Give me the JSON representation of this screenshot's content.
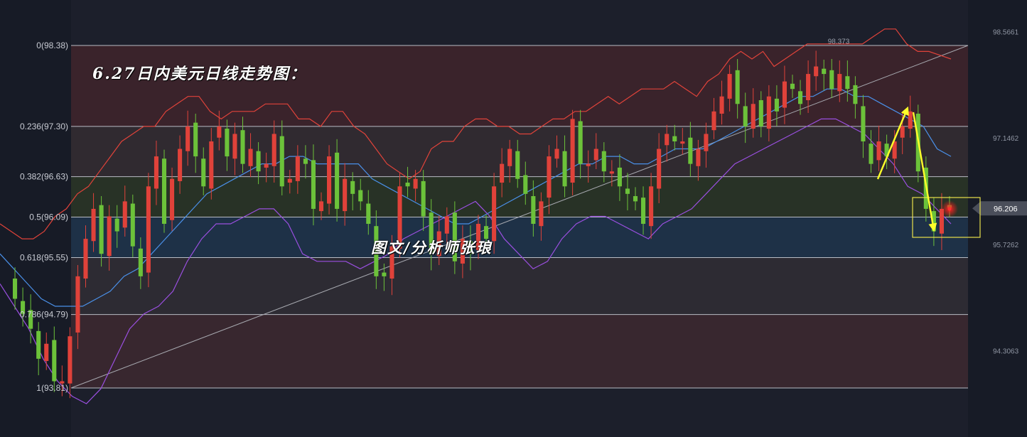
{
  "chart_data": {
    "type": "candlestick",
    "title": "6.27日内美元日线走势图：",
    "watermark": "图文/分析师张琅",
    "y_range": [
      92.9,
      99.0
    ],
    "fib_levels": [
      {
        "ratio": "0",
        "price": 98.38,
        "label": "0(98.38)"
      },
      {
        "ratio": "0.236",
        "price": 97.3,
        "label": "0.236(97.30)"
      },
      {
        "ratio": "0.382",
        "price": 96.63,
        "label": "0.382(96.63)"
      },
      {
        "ratio": "0.5",
        "price": 96.09,
        "label": "0.5(96.09)"
      },
      {
        "ratio": "0.618",
        "price": 95.55,
        "label": "0.618(95.55)"
      },
      {
        "ratio": "0.786",
        "price": 94.79,
        "label": "0.786(94.79)"
      },
      {
        "ratio": "1",
        "price": 93.81,
        "label": "1(93.81)"
      }
    ],
    "right_axis_ticks": [
      "98.5661",
      "97.1462",
      "95.7262",
      "94.3063"
    ],
    "right_axis_values": [
      98.5661,
      97.1462,
      95.7262,
      94.3063
    ],
    "current_price": "96.206",
    "current_price_value": 96.206,
    "high_marker": "98.373",
    "high_marker_value": 98.373,
    "trendline": {
      "from": 93.81,
      "to": 98.38
    },
    "closes": [
      95.3,
      95.0,
      94.8,
      94.6,
      94.2,
      94.4,
      93.9,
      93.9,
      94.5,
      95.3,
      95.8,
      96.2,
      95.6,
      96.1,
      95.9,
      96.3,
      95.7,
      95.3,
      96.5,
      96.9,
      96.0,
      96.6,
      97.0,
      97.3,
      96.9,
      96.5,
      97.1,
      97.3,
      96.9,
      97.2,
      96.8,
      97.0,
      96.7,
      96.8,
      97.2,
      96.5,
      96.6,
      96.9,
      96.8,
      96.2,
      96.3,
      96.9,
      96.2,
      96.6,
      96.4,
      96.3,
      96.0,
      95.3,
      95.3,
      95.7,
      96.5,
      96.5,
      96.6,
      96.1,
      95.6,
      95.9,
      96.1,
      95.5,
      95.8,
      95.6,
      96.0,
      95.8,
      96.5,
      96.8,
      97.0,
      96.6,
      96.4,
      96.0,
      96.3,
      96.9,
      97.0,
      96.5,
      97.4,
      96.8,
      96.8,
      97.0,
      96.7,
      96.7,
      96.5,
      96.4,
      96.3,
      96.0,
      96.5,
      97.0,
      97.2,
      97.1,
      97.1,
      96.8,
      97.0,
      97.2,
      97.5,
      97.7,
      98.0,
      97.6,
      97.3,
      97.6,
      97.3,
      97.7,
      97.5,
      97.9,
      97.8,
      97.6,
      98.0,
      98.1,
      98.0,
      97.8,
      98.0,
      97.8,
      97.6,
      97.1,
      96.8,
      97.1,
      96.9,
      97.1,
      97.3,
      97.5,
      96.7,
      96.2,
      95.9,
      96.2,
      96.21
    ],
    "bb_upper": [
      96.0,
      95.9,
      95.8,
      95.8,
      95.9,
      96.1,
      96.2,
      96.4,
      96.5,
      96.7,
      96.9,
      97.1,
      97.2,
      97.3,
      97.3,
      97.5,
      97.6,
      97.7,
      97.7,
      97.5,
      97.4,
      97.5,
      97.5,
      97.5,
      97.6,
      97.6,
      97.6,
      97.4,
      97.4,
      97.3,
      97.5,
      97.5,
      97.3,
      97.2,
      97.0,
      96.8,
      96.7,
      96.6,
      96.7,
      97.0,
      97.1,
      97.1,
      97.3,
      97.4,
      97.4,
      97.3,
      97.3,
      97.2,
      97.2,
      97.3,
      97.4,
      97.4,
      97.5,
      97.5,
      97.6,
      97.7,
      97.6,
      97.7,
      97.8,
      97.8,
      97.8,
      97.9,
      97.8,
      97.7,
      97.9,
      98.0,
      98.2,
      98.3,
      98.2,
      98.3,
      98.1,
      98.2,
      98.3,
      98.4,
      98.4,
      98.4,
      98.4,
      98.4,
      98.4,
      98.5,
      98.6,
      98.6,
      98.4,
      98.3,
      98.3,
      98.25,
      98.2
    ],
    "bb_mid": [
      95.6,
      95.4,
      95.2,
      95.0,
      94.9,
      94.9,
      94.9,
      95.0,
      95.1,
      95.3,
      95.4,
      95.6,
      95.8,
      96.0,
      96.2,
      96.4,
      96.5,
      96.6,
      96.7,
      96.8,
      96.8,
      96.9,
      96.9,
      96.8,
      96.8,
      96.8,
      96.8,
      96.6,
      96.5,
      96.4,
      96.3,
      96.2,
      96.1,
      96.0,
      96.0,
      96.1,
      96.2,
      96.3,
      96.4,
      96.5,
      96.6,
      96.7,
      96.8,
      96.8,
      96.9,
      96.9,
      96.8,
      96.8,
      96.9,
      97.0,
      97.0,
      97.0,
      97.1,
      97.2,
      97.3,
      97.4,
      97.5,
      97.6,
      97.7,
      97.7,
      97.8,
      97.8,
      97.7,
      97.7,
      97.6,
      97.5,
      97.4,
      97.3,
      97.0,
      96.9
    ],
    "bb_lower": [
      95.2,
      94.9,
      94.6,
      94.2,
      93.9,
      93.7,
      93.6,
      93.8,
      94.2,
      94.6,
      94.8,
      94.9,
      95.1,
      95.5,
      95.8,
      96.0,
      96.0,
      96.1,
      96.2,
      96.2,
      96.0,
      95.6,
      95.5,
      95.5,
      95.5,
      95.4,
      95.5,
      95.6,
      95.8,
      95.9,
      96.0,
      96.1,
      96.2,
      96.3,
      96.1,
      95.8,
      95.6,
      95.4,
      95.5,
      95.8,
      96.0,
      96.1,
      96.1,
      96.0,
      95.9,
      95.8,
      96.0,
      96.1,
      96.2,
      96.4,
      96.6,
      96.8,
      96.9,
      97.0,
      97.1,
      97.2,
      97.3,
      97.4,
      97.4,
      97.3,
      97.2,
      97.0,
      96.8,
      96.5,
      96.4,
      96.2,
      96.0
    ]
  }
}
